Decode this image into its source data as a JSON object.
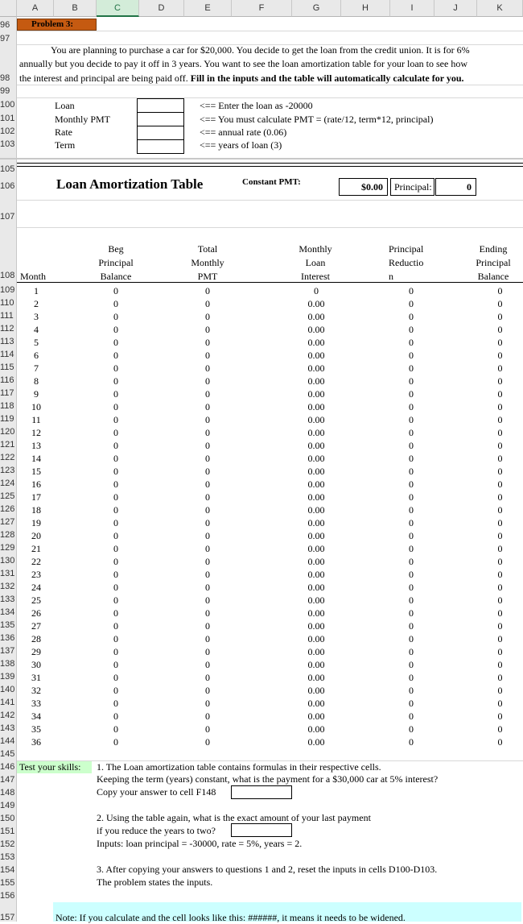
{
  "columns": [
    "A",
    "B",
    "C",
    "D",
    "E",
    "F",
    "G",
    "H",
    "I",
    "J",
    "K"
  ],
  "selected_column": "C",
  "problem_label": "Problem 3:",
  "intro": {
    "line1": "You are planning to purchase a car for $20,000.  You decide to get the loan from the credit union. It is for 6%",
    "line2": "annually but you decide to pay it off in 3 years.  You want to see the loan amortization table for your loan to see how",
    "line3a": "the interest and principal are being paid off.  ",
    "line3b": "Fill in the inputs and the table will automatically calculate for you."
  },
  "inputs": [
    {
      "label": "Loan",
      "hint": "<== Enter the loan as -20000",
      "value": ""
    },
    {
      "label": "Monthly PMT",
      "hint": "<== You must calculate  PMT = (rate/12, term*12, principal)",
      "value": ""
    },
    {
      "label": "Rate",
      "hint": "<== annual rate (0.06)",
      "value": ""
    },
    {
      "label": "Term",
      "hint": "<== years of loan (3)",
      "value": ""
    }
  ],
  "table_title": "Loan Amortization Table",
  "constant_pmt_label": "Constant PMT:",
  "constant_pmt_value": "$0.00",
  "principal_label": "Principal:",
  "principal_value": "0",
  "headers": {
    "month": "Month",
    "beg": [
      "Beg",
      "Principal",
      "Balance"
    ],
    "total": [
      "Total",
      "Monthly",
      "PMT"
    ],
    "interest": [
      "Monthly",
      "Loan",
      "Interest"
    ],
    "reduction": [
      "Principal",
      "Reductio",
      "n"
    ],
    "ending": [
      "Ending",
      "Principal",
      "Balance"
    ]
  },
  "rows": [
    {
      "r": "109",
      "m": "1",
      "b": "0",
      "t": "0",
      "i": "0",
      "p": "0",
      "e": "0"
    },
    {
      "r": "110",
      "m": "2",
      "b": "0",
      "t": "0",
      "i": "0.00",
      "p": "0",
      "e": "0"
    },
    {
      "r": "111",
      "m": "3",
      "b": "0",
      "t": "0",
      "i": "0.00",
      "p": "0",
      "e": "0"
    },
    {
      "r": "112",
      "m": "4",
      "b": "0",
      "t": "0",
      "i": "0.00",
      "p": "0",
      "e": "0"
    },
    {
      "r": "113",
      "m": "5",
      "b": "0",
      "t": "0",
      "i": "0.00",
      "p": "0",
      "e": "0"
    },
    {
      "r": "114",
      "m": "6",
      "b": "0",
      "t": "0",
      "i": "0.00",
      "p": "0",
      "e": "0"
    },
    {
      "r": "115",
      "m": "7",
      "b": "0",
      "t": "0",
      "i": "0.00",
      "p": "0",
      "e": "0"
    },
    {
      "r": "116",
      "m": "8",
      "b": "0",
      "t": "0",
      "i": "0.00",
      "p": "0",
      "e": "0"
    },
    {
      "r": "117",
      "m": "9",
      "b": "0",
      "t": "0",
      "i": "0.00",
      "p": "0",
      "e": "0"
    },
    {
      "r": "118",
      "m": "10",
      "b": "0",
      "t": "0",
      "i": "0.00",
      "p": "0",
      "e": "0"
    },
    {
      "r": "119",
      "m": "11",
      "b": "0",
      "t": "0",
      "i": "0.00",
      "p": "0",
      "e": "0"
    },
    {
      "r": "120",
      "m": "12",
      "b": "0",
      "t": "0",
      "i": "0.00",
      "p": "0",
      "e": "0"
    },
    {
      "r": "121",
      "m": "13",
      "b": "0",
      "t": "0",
      "i": "0.00",
      "p": "0",
      "e": "0"
    },
    {
      "r": "122",
      "m": "14",
      "b": "0",
      "t": "0",
      "i": "0.00",
      "p": "0",
      "e": "0"
    },
    {
      "r": "123",
      "m": "15",
      "b": "0",
      "t": "0",
      "i": "0.00",
      "p": "0",
      "e": "0"
    },
    {
      "r": "124",
      "m": "16",
      "b": "0",
      "t": "0",
      "i": "0.00",
      "p": "0",
      "e": "0"
    },
    {
      "r": "125",
      "m": "17",
      "b": "0",
      "t": "0",
      "i": "0.00",
      "p": "0",
      "e": "0"
    },
    {
      "r": "126",
      "m": "18",
      "b": "0",
      "t": "0",
      "i": "0.00",
      "p": "0",
      "e": "0"
    },
    {
      "r": "127",
      "m": "19",
      "b": "0",
      "t": "0",
      "i": "0.00",
      "p": "0",
      "e": "0"
    },
    {
      "r": "128",
      "m": "20",
      "b": "0",
      "t": "0",
      "i": "0.00",
      "p": "0",
      "e": "0"
    },
    {
      "r": "129",
      "m": "21",
      "b": "0",
      "t": "0",
      "i": "0.00",
      "p": "0",
      "e": "0"
    },
    {
      "r": "130",
      "m": "22",
      "b": "0",
      "t": "0",
      "i": "0.00",
      "p": "0",
      "e": "0"
    },
    {
      "r": "131",
      "m": "23",
      "b": "0",
      "t": "0",
      "i": "0.00",
      "p": "0",
      "e": "0"
    },
    {
      "r": "132",
      "m": "24",
      "b": "0",
      "t": "0",
      "i": "0.00",
      "p": "0",
      "e": "0"
    },
    {
      "r": "133",
      "m": "25",
      "b": "0",
      "t": "0",
      "i": "0.00",
      "p": "0",
      "e": "0"
    },
    {
      "r": "134",
      "m": "26",
      "b": "0",
      "t": "0",
      "i": "0.00",
      "p": "0",
      "e": "0"
    },
    {
      "r": "135",
      "m": "27",
      "b": "0",
      "t": "0",
      "i": "0.00",
      "p": "0",
      "e": "0"
    },
    {
      "r": "136",
      "m": "28",
      "b": "0",
      "t": "0",
      "i": "0.00",
      "p": "0",
      "e": "0"
    },
    {
      "r": "137",
      "m": "29",
      "b": "0",
      "t": "0",
      "i": "0.00",
      "p": "0",
      "e": "0"
    },
    {
      "r": "138",
      "m": "30",
      "b": "0",
      "t": "0",
      "i": "0.00",
      "p": "0",
      "e": "0"
    },
    {
      "r": "139",
      "m": "31",
      "b": "0",
      "t": "0",
      "i": "0.00",
      "p": "0",
      "e": "0"
    },
    {
      "r": "140",
      "m": "32",
      "b": "0",
      "t": "0",
      "i": "0.00",
      "p": "0",
      "e": "0"
    },
    {
      "r": "141",
      "m": "33",
      "b": "0",
      "t": "0",
      "i": "0.00",
      "p": "0",
      "e": "0"
    },
    {
      "r": "142",
      "m": "34",
      "b": "0",
      "t": "0",
      "i": "0.00",
      "p": "0",
      "e": "0"
    },
    {
      "r": "143",
      "m": "35",
      "b": "0",
      "t": "0",
      "i": "0.00",
      "p": "0",
      "e": "0"
    },
    {
      "r": "144",
      "m": "36",
      "b": "0",
      "t": "0",
      "i": "0.00",
      "p": "0",
      "e": "0"
    }
  ],
  "skills_label": "Test your skills:",
  "q1": {
    "line1": "1.  The Loan amortization table contains formulas in their respective cells.",
    "line2": "Keeping the term (years) constant, what is the payment for a $30,000 car at 5% interest?",
    "line3": "Copy your answer to cell F148",
    "answer": ""
  },
  "q2": {
    "line1": "2.  Using the table again, what is the exact amount of your last payment",
    "line2": "if you reduce the years to two?",
    "line3": "Inputs: loan principal = -30000, rate = 5%, years = 2.",
    "answer": ""
  },
  "q3": {
    "line1": "3. After copying your answers to questions 1 and 2, reset the inputs in cells D100-D103.",
    "line2": "The problem states the inputs."
  },
  "note": "Note: If you calculate and the cell looks like this:  ######,  it means it needs to be widened.",
  "colors": {
    "problem_bg": "#c55a11",
    "skills_bg": "#ccffcc",
    "note_bg": "#ccffff",
    "selected_header": "#217346"
  }
}
